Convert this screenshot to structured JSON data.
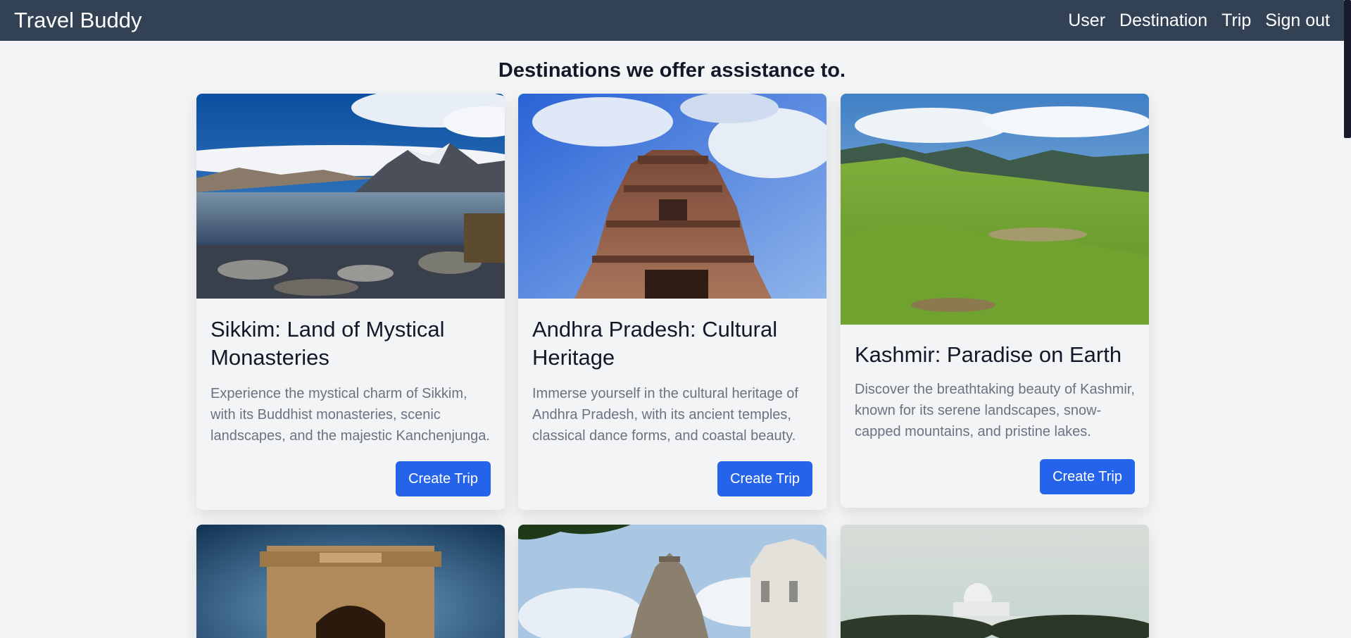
{
  "navbar": {
    "brand": "Travel Buddy",
    "links": [
      "User",
      "Destination",
      "Trip",
      "Sign out"
    ]
  },
  "page": {
    "heading": "Destinations we offer assistance to."
  },
  "destinations": [
    {
      "title": "Sikkim: Land of Mystical Monasteries",
      "description": "Experience the mystical charm of Sikkim, with its Buddhist monasteries, scenic landscapes, and the majestic Kanchenjunga.",
      "button": "Create Trip",
      "image": "mountain-lake-photo"
    },
    {
      "title": "Andhra Pradesh: Cultural Heritage",
      "description": "Immerse yourself in the cultural heritage of Andhra Pradesh, with its ancient temples, classical dance forms, and coastal beauty.",
      "button": "Create Trip",
      "image": "temple-tower-photo"
    },
    {
      "title": "Kashmir: Paradise on Earth",
      "description": "Discover the breathtaking beauty of Kashmir, known for its serene landscapes, snow-capped mountains, and pristine lakes.",
      "button": "Create Trip",
      "image": "green-meadow-photo"
    },
    {
      "image": "india-gate-photo"
    },
    {
      "image": "carved-temples-photo"
    },
    {
      "image": "white-memorial-photo"
    }
  ],
  "colors": {
    "navbar": "#334155",
    "background": "#f2f4f6",
    "button": "#2563eb",
    "text_muted": "#6b7280"
  }
}
